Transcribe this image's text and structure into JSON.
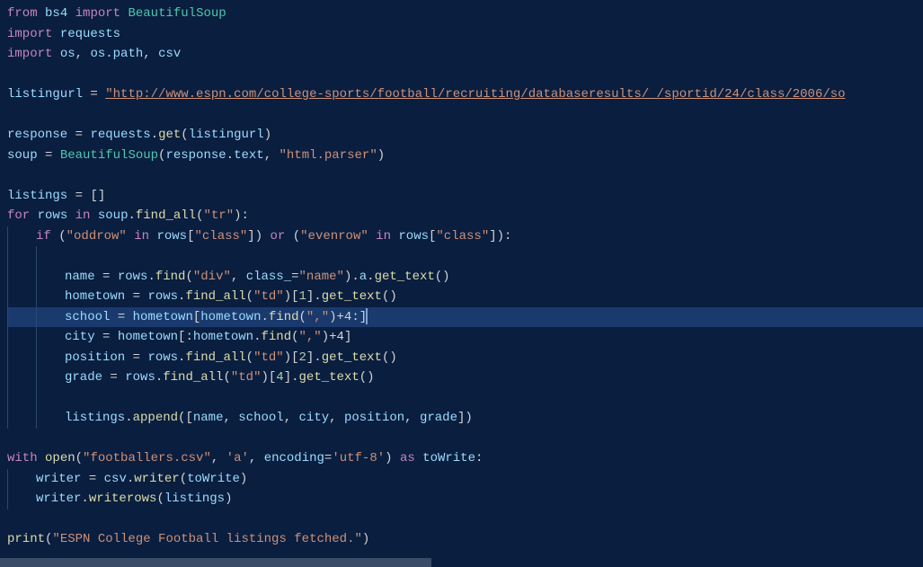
{
  "code": {
    "l1": {
      "from": "from",
      "bs4": "bs4",
      "import": "import",
      "BeautifulSoup": "BeautifulSoup"
    },
    "l2": {
      "import": "import",
      "requests": "requests"
    },
    "l3": {
      "import": "import",
      "os": "os",
      "ospath": "os.path",
      "csv": "csv"
    },
    "l5": {
      "listingurl": "listingurl",
      "eq": "=",
      "url": "\"http://www.espn.com/college-sports/football/recruiting/databaseresults/_/sportid/24/class/2006/so"
    },
    "l7": {
      "response": "response",
      "eq": "=",
      "requests": "requests",
      "get": "get",
      "listingurl": "listingurl"
    },
    "l8": {
      "soup": "soup",
      "eq": "=",
      "BeautifulSoup": "BeautifulSoup",
      "response": "response",
      "text": "text",
      "parser": "\"html.parser\""
    },
    "l10": {
      "listings": "listings",
      "eq": "=",
      "brackets": "[]"
    },
    "l11": {
      "for": "for",
      "rows": "rows",
      "in": "in",
      "soup": "soup",
      "find_all": "find_all",
      "tr": "\"tr\""
    },
    "l12": {
      "if": "if",
      "oddrow": "\"oddrow\"",
      "in": "in",
      "rows": "rows",
      "class1": "\"class\"",
      "or": "or",
      "evenrow": "\"evenrow\"",
      "class2": "\"class\""
    },
    "l14": {
      "name": "name",
      "eq": "=",
      "rows": "rows",
      "find": "find",
      "div": "\"div\"",
      "class_": "class_",
      "nameval": "\"name\"",
      "a": "a",
      "get_text": "get_text"
    },
    "l15": {
      "hometown": "hometown",
      "eq": "=",
      "rows": "rows",
      "find_all": "find_all",
      "td": "\"td\"",
      "idx": "1",
      "get_text": "get_text"
    },
    "l16": {
      "school": "school",
      "eq": "=",
      "hometown": "hometown",
      "hometown2": "hometown",
      "find": "find",
      "comma": "\",\"",
      "plus4": "+4",
      "colon": ":"
    },
    "l17": {
      "city": "city",
      "eq": "=",
      "hometown": "hometown",
      "hometown2": "hometown",
      "find": "find",
      "comma": "\",\"",
      "plus4": "+4"
    },
    "l18": {
      "position": "position",
      "eq": "=",
      "rows": "rows",
      "find_all": "find_all",
      "td": "\"td\"",
      "idx": "2",
      "get_text": "get_text"
    },
    "l19": {
      "grade": "grade",
      "eq": "=",
      "rows": "rows",
      "find_all": "find_all",
      "td": "\"td\"",
      "idx": "4",
      "get_text": "get_text"
    },
    "l21": {
      "listings": "listings",
      "append": "append",
      "name": "name",
      "school": "school",
      "city": "city",
      "position": "position",
      "grade": "grade"
    },
    "l23": {
      "with": "with",
      "open": "open",
      "fname": "\"footballers.csv\"",
      "mode": "'a'",
      "encoding": "encoding",
      "utf8": "'utf-8'",
      "as": "as",
      "toWrite": "toWrite"
    },
    "l24": {
      "writer": "writer",
      "eq": "=",
      "csv": "csv",
      "writerfn": "writer",
      "toWrite": "toWrite"
    },
    "l25": {
      "writer": "writer",
      "writerows": "writerows",
      "listings": "listings"
    },
    "l27": {
      "print": "print",
      "msg": "\"ESPN College Football listings fetched.\""
    }
  }
}
